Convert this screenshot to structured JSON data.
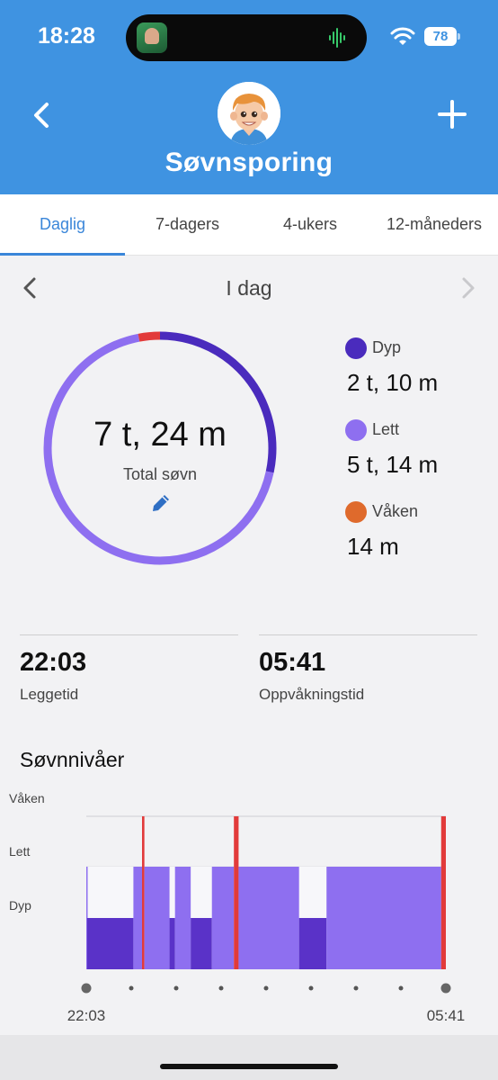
{
  "status_bar": {
    "time": "18:28",
    "battery": "78",
    "icons": [
      "wifi-icon",
      "battery-icon",
      "waveform-icon"
    ]
  },
  "header": {
    "title": "Søvnsporing",
    "back_icon": "chevron-left-icon",
    "add_icon": "plus-icon",
    "avatar": "boy-avatar"
  },
  "tabs": [
    {
      "label": "Daglig",
      "active": true
    },
    {
      "label": "7-dagers",
      "active": false
    },
    {
      "label": "4-ukers",
      "active": false
    },
    {
      "label": "12-måneders",
      "active": false
    }
  ],
  "day_nav": {
    "label": "I dag"
  },
  "summary": {
    "total_value": "7 t, 24 m",
    "total_label": "Total søvn",
    "ring_minutes": {
      "deep": 130,
      "light": 314,
      "awake": 14
    }
  },
  "legend": [
    {
      "name": "Dyp",
      "value": "2 t, 10 m",
      "color": "#4a2bbd"
    },
    {
      "name": "Lett",
      "value": "5 t, 14 m",
      "color": "#8e6ff0"
    },
    {
      "name": "Våken",
      "value": "14 m",
      "color": "#df6a2c"
    }
  ],
  "times": {
    "bedtime_value": "22:03",
    "bedtime_label": "Leggetid",
    "wake_value": "05:41",
    "wake_label": "Oppvåkningstid"
  },
  "levels": {
    "title": "Søvnnivåer",
    "levels": [
      "Våken",
      "Lett",
      "Dyp"
    ],
    "start": "22:03",
    "end": "05:41",
    "colors": {
      "deep": "#5a32c8",
      "light": "#8e6ff0",
      "awake": "#e23a3a"
    }
  },
  "chart_data": {
    "type": "area",
    "x_labels": [
      "22:03",
      "05:41"
    ],
    "y_levels": [
      "Dyp",
      "Lett",
      "Våken"
    ],
    "segments": [
      {
        "level": "Lett",
        "start_min": 0,
        "end_min": 1
      },
      {
        "level": "Dyp",
        "start_min": 1,
        "end_min": 60
      },
      {
        "level": "Lett",
        "start_min": 60,
        "end_min": 71
      },
      {
        "level": "Våken",
        "start_min": 71,
        "end_min": 74
      },
      {
        "level": "Lett",
        "start_min": 74,
        "end_min": 106
      },
      {
        "level": "Dyp",
        "start_min": 106,
        "end_min": 113
      },
      {
        "level": "Lett",
        "start_min": 113,
        "end_min": 133
      },
      {
        "level": "Dyp",
        "start_min": 133,
        "end_min": 160
      },
      {
        "level": "Lett",
        "start_min": 160,
        "end_min": 188
      },
      {
        "level": "Våken",
        "start_min": 188,
        "end_min": 194
      },
      {
        "level": "Lett",
        "start_min": 194,
        "end_min": 271
      },
      {
        "level": "Dyp",
        "start_min": 271,
        "end_min": 306
      },
      {
        "level": "Lett",
        "start_min": 306,
        "end_min": 452
      },
      {
        "level": "Våken",
        "start_min": 452,
        "end_min": 458
      }
    ],
    "total_minutes": 458
  }
}
